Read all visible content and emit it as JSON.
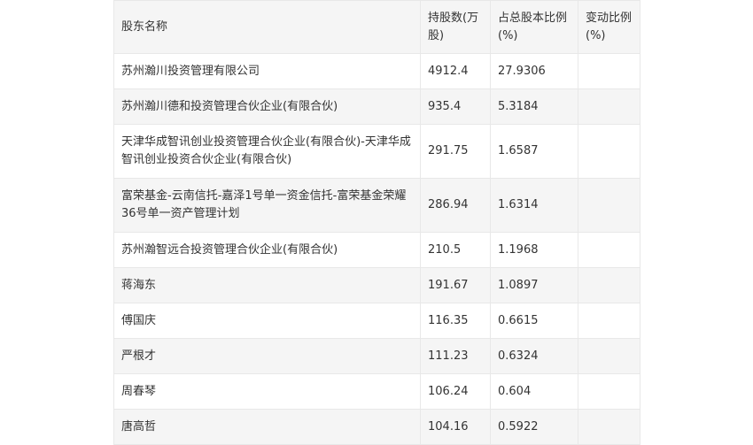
{
  "table": {
    "headers": [
      "股东名称",
      "持股数(万股)",
      "占总股本比例(%)",
      "变动比例(%)"
    ],
    "rows": [
      {
        "name": "苏州瀚川投资管理有限公司",
        "shares": "4912.4",
        "ratio": "27.9306",
        "change": ""
      },
      {
        "name": "苏州瀚川德和投资管理合伙企业(有限合伙)",
        "shares": "935.4",
        "ratio": "5.3184",
        "change": ""
      },
      {
        "name": "天津华成智讯创业投资管理合伙企业(有限合伙)-天津华成智讯创业投资合伙企业(有限合伙)",
        "shares": "291.75",
        "ratio": "1.6587",
        "change": ""
      },
      {
        "name": "富荣基金-云南信托-嘉泽1号单一资金信托-富荣基金荣耀36号单一资产管理计划",
        "shares": "286.94",
        "ratio": "1.6314",
        "change": ""
      },
      {
        "name": "苏州瀚智远合投资管理合伙企业(有限合伙)",
        "shares": "210.5",
        "ratio": "1.1968",
        "change": ""
      },
      {
        "name": "蒋海东",
        "shares": "191.67",
        "ratio": "1.0897",
        "change": ""
      },
      {
        "name": "傅国庆",
        "shares": "116.35",
        "ratio": "0.6615",
        "change": ""
      },
      {
        "name": "严根才",
        "shares": "111.23",
        "ratio": "0.6324",
        "change": ""
      },
      {
        "name": "周春琴",
        "shares": "106.24",
        "ratio": "0.604",
        "change": ""
      },
      {
        "name": "唐高哲",
        "shares": "104.16",
        "ratio": "0.5922",
        "change": ""
      }
    ]
  }
}
